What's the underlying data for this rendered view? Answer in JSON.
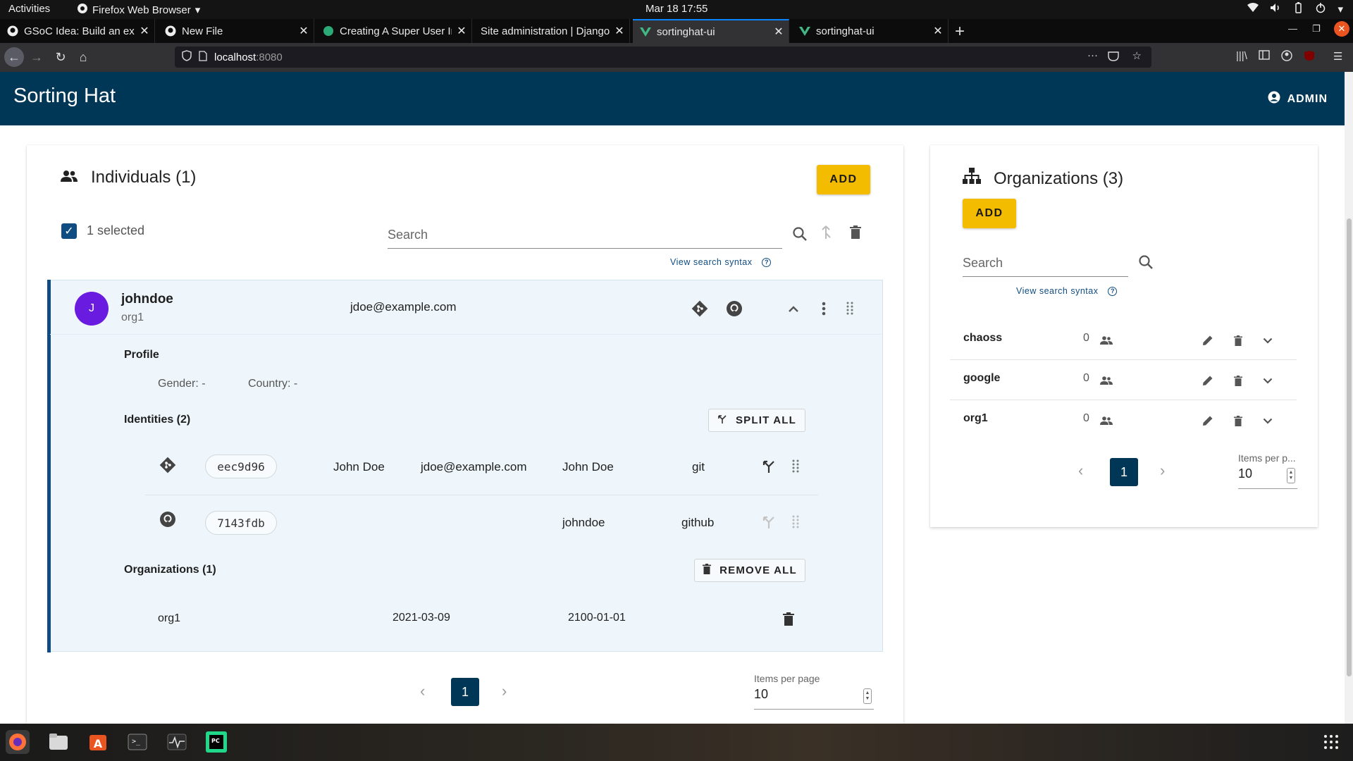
{
  "system": {
    "activities": "Activities",
    "app_name": "Firefox Web Browser",
    "clock": "Mar 18  17:55"
  },
  "browser": {
    "tabs": [
      {
        "title": "GSoC Idea: Build an expe"
      },
      {
        "title": "New File"
      },
      {
        "title": "Creating A Super User In"
      },
      {
        "title": "Site administration | Django"
      },
      {
        "title": "sortinghat-ui"
      },
      {
        "title": "sortinghat-ui"
      }
    ],
    "url_host": "localhost",
    "url_port": ":8080"
  },
  "app": {
    "title": "Sorting Hat",
    "user": "ADMIN"
  },
  "individuals": {
    "title": "Individuals (1)",
    "add_label": "ADD",
    "selected_text": "1 selected",
    "search_placeholder": "Search",
    "syntax_link": "View search syntax",
    "row": {
      "avatar_letter": "J",
      "name": "johndoe",
      "org": "org1",
      "email": "jdoe@example.com",
      "profile_title": "Profile",
      "gender": "Gender: -",
      "country": "Country: -",
      "identities_title": "Identities (2)",
      "split_all": "SPLIT ALL",
      "identities": [
        {
          "uuid": "eec9d96",
          "name": "John Doe",
          "email": "jdoe@example.com",
          "username": "John Doe",
          "source": "git",
          "icon": "git-icon"
        },
        {
          "uuid": "7143fdb",
          "name": "",
          "email": "",
          "username": "johndoe",
          "source": "github",
          "icon": "github-icon"
        }
      ],
      "orgs_title": "Organizations (1)",
      "remove_all": "REMOVE ALL",
      "enrollments": [
        {
          "org": "org1",
          "start": "2021-03-09",
          "end": "2100-01-01"
        }
      ]
    },
    "pagination": {
      "page": "1",
      "items_per_page_label": "Items per page",
      "items_per_page": "10"
    }
  },
  "organizations": {
    "title": "Organizations (3)",
    "add_label": "ADD",
    "search_placeholder": "Search",
    "syntax_link": "View search syntax",
    "items": [
      {
        "name": "chaoss",
        "count": "0"
      },
      {
        "name": "google",
        "count": "0"
      },
      {
        "name": "org1",
        "count": "0"
      }
    ],
    "pagination": {
      "page": "1",
      "items_per_page_label": "Items per p...",
      "items_per_page": "10"
    }
  },
  "colors": {
    "header": "#003756",
    "accent": "#f4bc00",
    "avatar": "#6a1be0",
    "active_tab": "#0a84ff"
  }
}
